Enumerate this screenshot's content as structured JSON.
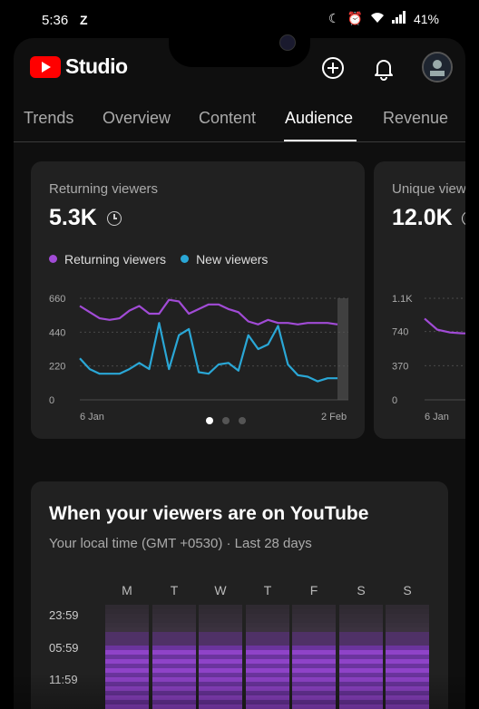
{
  "status_bar": {
    "time": "5:36",
    "notification": "Z",
    "battery": "41%"
  },
  "header": {
    "app_name": "Studio",
    "brand_color": "#ff0000"
  },
  "tabs": [
    {
      "label": "Trends"
    },
    {
      "label": "Overview"
    },
    {
      "label": "Content"
    },
    {
      "label": "Audience",
      "active": true
    },
    {
      "label": "Revenue"
    }
  ],
  "card1": {
    "title": "Returning viewers",
    "value": "5.3K",
    "legend": [
      {
        "name": "Returning viewers",
        "color": "#a14bd6"
      },
      {
        "name": "New viewers",
        "color": "#2aa7d6"
      }
    ]
  },
  "card2": {
    "title": "Unique viewers",
    "value": "12.0K"
  },
  "chart_data": [
    {
      "type": "line",
      "x_labels": [
        "6 Jan",
        "2 Feb"
      ],
      "yticks": [
        0,
        220,
        440,
        660
      ],
      "ylim": [
        0,
        660
      ],
      "series": [
        {
          "name": "Returning viewers",
          "color": "#a14bd6",
          "values": [
            610,
            570,
            530,
            520,
            530,
            580,
            610,
            560,
            560,
            650,
            640,
            560,
            590,
            620,
            620,
            590,
            570,
            510,
            490,
            520,
            500,
            500,
            490,
            500,
            500,
            500,
            490
          ]
        },
        {
          "name": "New viewers",
          "color": "#2aa7d6",
          "values": [
            270,
            200,
            170,
            170,
            170,
            200,
            240,
            200,
            500,
            200,
            420,
            460,
            180,
            170,
            230,
            240,
            190,
            420,
            330,
            360,
            480,
            230,
            160,
            150,
            120,
            140,
            140
          ]
        }
      ]
    },
    {
      "type": "line",
      "x_labels": [
        "6 Jan"
      ],
      "yticks": [
        "0",
        "370",
        "740",
        "1.1K"
      ],
      "series": [
        {
          "name": "Unique viewers",
          "color": "#a14bd6",
          "values": [
            880,
            760,
            730,
            720,
            720
          ]
        }
      ]
    }
  ],
  "heatmap": {
    "title": "When your viewers are on YouTube",
    "subtitle": "Your local time (GMT +0530) · Last 28 days",
    "days": [
      "M",
      "T",
      "W",
      "T",
      "F",
      "S",
      "S"
    ],
    "times": [
      "23:59",
      "05:59",
      "11:59"
    ]
  }
}
